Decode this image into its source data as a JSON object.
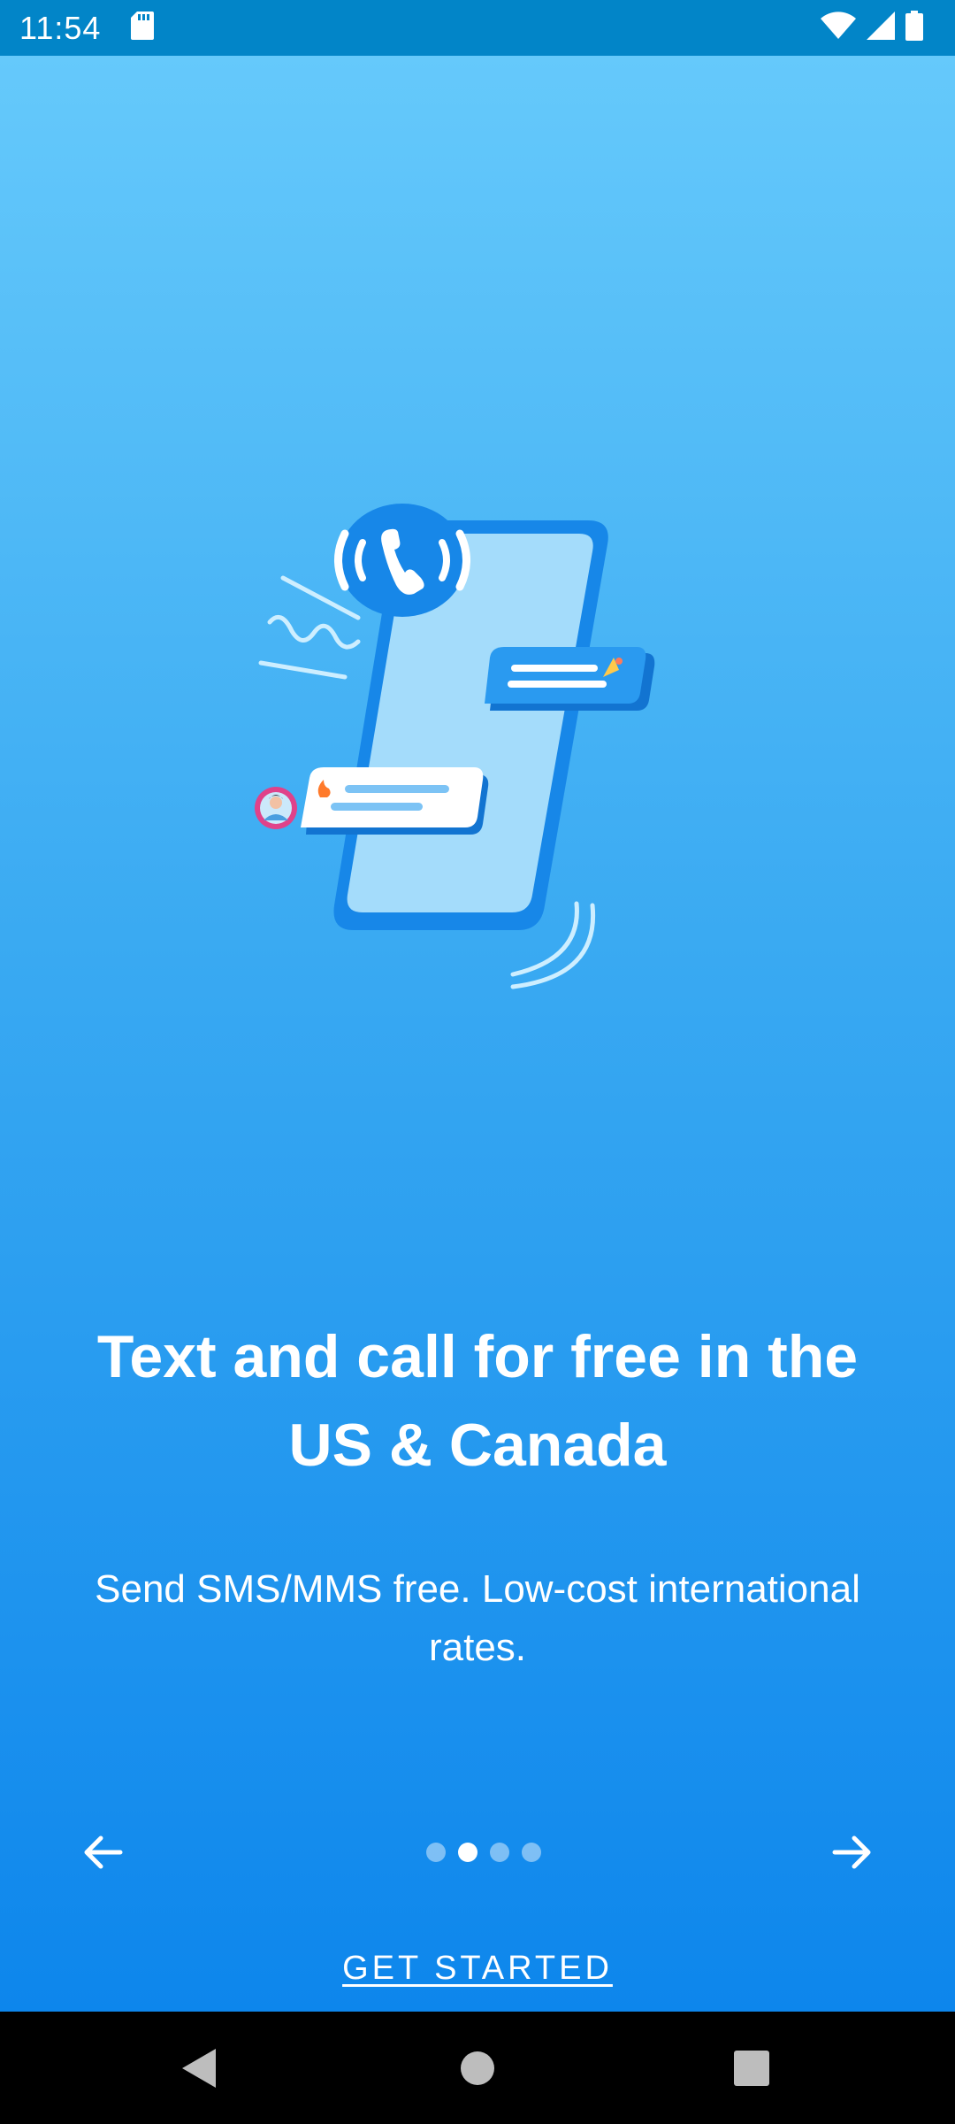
{
  "status_bar": {
    "time": "11:54",
    "icons": [
      "sd-card-icon",
      "wifi-icon",
      "cellular-signal-icon",
      "battery-icon"
    ]
  },
  "onboarding": {
    "headline": "Text and call for free in the US & Canada",
    "subtitle": "Send SMS/MMS free. Low-cost international rates.",
    "page_indicator": {
      "total": 4,
      "current": 2
    },
    "prev_icon": "arrow-left-icon",
    "next_icon": "arrow-right-icon",
    "get_started_label": "GET STARTED"
  },
  "system_nav": {
    "icons": [
      "back-icon",
      "home-icon",
      "recents-icon"
    ]
  },
  "colors": {
    "status_bar": "#0285c8",
    "gradient_top": "#65c9fb",
    "gradient_bottom": "#0d86ec",
    "phone_blue": "#1787e8",
    "phone_screen": "#a4dcfb"
  }
}
